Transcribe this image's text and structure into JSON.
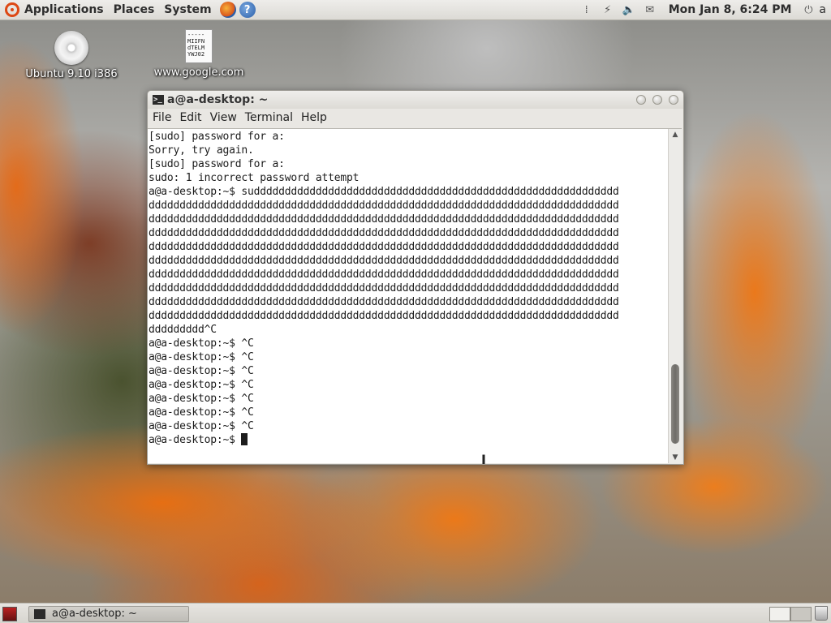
{
  "top_panel": {
    "menus": [
      "Applications",
      "Places",
      "System"
    ],
    "clock": "Mon Jan  8,  6:24 PM",
    "user": "a"
  },
  "desktop": {
    "icons": [
      {
        "label": "Ubuntu 9.10 i386"
      },
      {
        "label": "www.google.com",
        "preview_text": "-----\nMIIFN\ndTELM\nYWJ02"
      }
    ]
  },
  "terminal": {
    "title": "a@a-desktop: ~",
    "menu": [
      "File",
      "Edit",
      "View",
      "Terminal",
      "Help"
    ],
    "lines": [
      "[sudo] password for a:",
      "Sorry, try again.",
      "[sudo] password for a:",
      "sudo: 1 incorrect password attempt",
      "a@a-desktop:~$ suddddddddddddddddddddddddddddddddddddddddddddddddddddddddddd",
      "dddddddddddddddddddddddddddddddddddddddddddddddddddddddddddddddddddddddddddd",
      "dddddddddddddddddddddddddddddddddddddddddddddddddddddddddddddddddddddddddddd",
      "dddddddddddddddddddddddddddddddddddddddddddddddddddddddddddddddddddddddddddd",
      "dddddddddddddddddddddddddddddddddddddddddddddddddddddddddddddddddddddddddddd",
      "dddddddddddddddddddddddddddddddddddddddddddddddddddddddddddddddddddddddddddd",
      "dddddddddddddddddddddddddddddddddddddddddddddddddddddddddddddddddddddddddddd",
      "dddddddddddddddddddddddddddddddddddddddddddddddddddddddddddddddddddddddddddd",
      "dddddddddddddddddddddddddddddddddddddddddddddddddddddddddddddddddddddddddddd",
      "dddddddddddddddddddddddddddddddddddddddddddddddddddddddddddddddddddddddddddd",
      "ddddddddd^C",
      "a@a-desktop:~$ ^C",
      "a@a-desktop:~$ ^C",
      "a@a-desktop:~$ ^C",
      "a@a-desktop:~$ ^C",
      "a@a-desktop:~$ ^C",
      "a@a-desktop:~$ ^C",
      "a@a-desktop:~$ ^C"
    ],
    "prompt": "a@a-desktop:~$ "
  },
  "bottom_panel": {
    "taskbar_item": "a@a-desktop: ~"
  },
  "colors": {
    "accent_ubuntu": "#dd4814",
    "terminal_bg": "#ffffff",
    "terminal_fg": "#1c1c1c"
  },
  "icons": [
    "ubuntu-logo-icon",
    "firefox-icon",
    "help-icon",
    "network-icon",
    "volume-icon",
    "mail-icon",
    "power-icon",
    "cd-icon",
    "certificate-file-icon",
    "terminal-icon",
    "trash-icon"
  ]
}
